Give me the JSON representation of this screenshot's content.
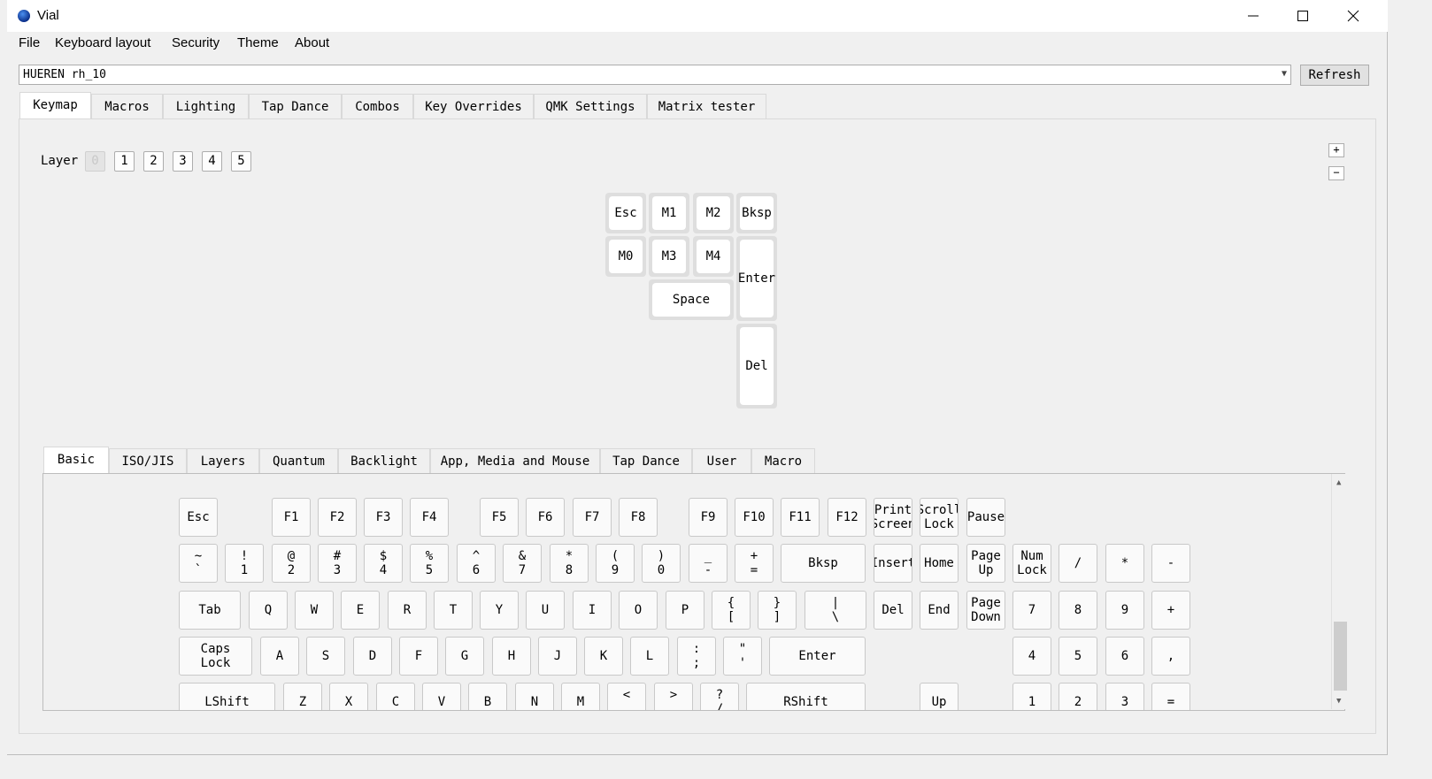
{
  "window": {
    "title": "Vial"
  },
  "menu": [
    "File",
    "Keyboard layout",
    "Security",
    "Theme",
    "About"
  ],
  "device": {
    "selected": "HUEREN rh_10",
    "refresh_label": "Refresh"
  },
  "main_tabs": [
    "Keymap",
    "Macros",
    "Lighting",
    "Tap Dance",
    "Combos",
    "Key Overrides",
    "QMK Settings",
    "Matrix tester"
  ],
  "active_main_tab": "Keymap",
  "layer": {
    "label": "Layer",
    "buttons": [
      "0",
      "1",
      "2",
      "3",
      "4",
      "5"
    ],
    "active": "0"
  },
  "zoom": {
    "in": "+",
    "out": "−"
  },
  "keyboard": {
    "keys": [
      "Esc",
      "M1",
      "M2",
      "Bksp",
      "M0",
      "M3",
      "M4",
      "Enter",
      "Space",
      "Del"
    ]
  },
  "keycode_tabs": [
    "Basic",
    "ISO/JIS",
    "Layers",
    "Quantum",
    "Backlight",
    "App, Media and Mouse",
    "Tap Dance",
    "User",
    "Macro"
  ],
  "active_keycode_tab": "Basic",
  "keycodes": {
    "row0": [
      "Esc",
      "F1",
      "F2",
      "F3",
      "F4",
      "F5",
      "F6",
      "F7",
      "F8",
      "F9",
      "F10",
      "F11",
      "F12",
      "Print\nScreen",
      "Scroll\nLock",
      "Pause"
    ],
    "row1": [
      "~\n`",
      "!\n1",
      "@\n2",
      "#\n3",
      "$\n4",
      "%\n5",
      "^\n6",
      "&\n7",
      "*\n8",
      "(\n9",
      ")\n0",
      "_\n-",
      "+\n=",
      "Bksp",
      "Insert",
      "Home",
      "Page\nUp",
      "Num\nLock",
      "/",
      "*",
      "-"
    ],
    "row2": [
      "Tab",
      "Q",
      "W",
      "E",
      "R",
      "T",
      "Y",
      "U",
      "I",
      "O",
      "P",
      "{\n[",
      "}\n]",
      "|\n\\",
      "Del",
      "End",
      "Page\nDown",
      "7",
      "8",
      "9",
      "+"
    ],
    "row3": [
      "Caps\nLock",
      "A",
      "S",
      "D",
      "F",
      "G",
      "H",
      "J",
      "K",
      "L",
      ":\n;",
      "\"\n'",
      "Enter",
      "4",
      "5",
      "6",
      ","
    ],
    "row4": [
      "LShift",
      "Z",
      "X",
      "C",
      "V",
      "B",
      "N",
      "M",
      "<\n,",
      ">\n.",
      "?\n/",
      "RShift",
      "Up",
      "1",
      "2",
      "3",
      "="
    ]
  }
}
